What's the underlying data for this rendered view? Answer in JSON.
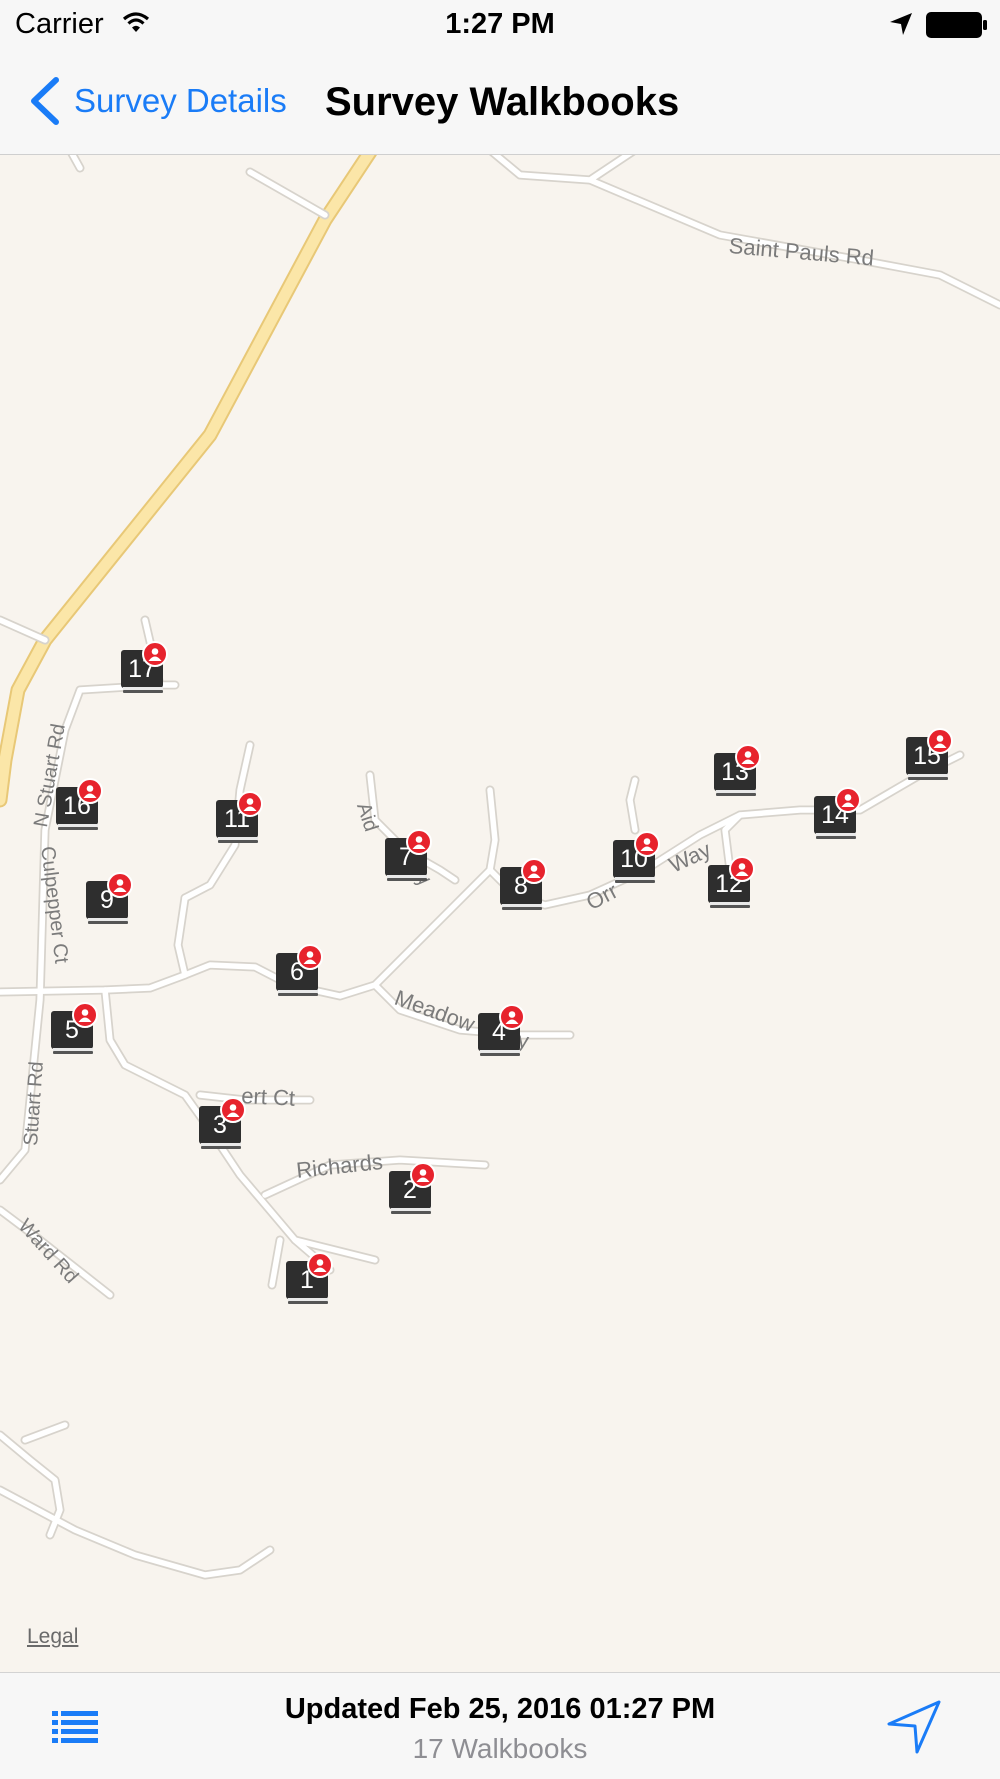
{
  "status_bar": {
    "carrier": "Carrier",
    "time": "1:27 PM",
    "icons": [
      "wifi-icon",
      "location-arrow-icon",
      "battery-icon"
    ]
  },
  "nav": {
    "back_label": "Survey Details",
    "title": "Survey Walkbooks"
  },
  "map": {
    "legal": "Legal",
    "road_labels": [
      "Saint Pauls Rd",
      "N Stuart Rd",
      "Culpepper Ct",
      "Stuart Rd",
      "Ward Rd",
      "Meadow",
      "y",
      "Richards",
      "ert Ct",
      "Aid",
      "ay",
      "Orr",
      "Way"
    ],
    "walkbooks": [
      {
        "number": "1"
      },
      {
        "number": "2"
      },
      {
        "number": "3"
      },
      {
        "number": "4"
      },
      {
        "number": "5"
      },
      {
        "number": "6"
      },
      {
        "number": "7"
      },
      {
        "number": "8"
      },
      {
        "number": "9"
      },
      {
        "number": "10"
      },
      {
        "number": "11"
      },
      {
        "number": "12"
      },
      {
        "number": "13"
      },
      {
        "number": "14"
      },
      {
        "number": "15"
      },
      {
        "number": "16"
      },
      {
        "number": "17"
      }
    ]
  },
  "toolbar": {
    "updated": "Updated Feb 25, 2016 01:27 PM",
    "count": "17 Walkbooks"
  },
  "colors": {
    "accent": "#1a7cf7",
    "badge": "#e7232d",
    "map_background": "#f8f4ee",
    "major_road": "#f7d98a"
  }
}
